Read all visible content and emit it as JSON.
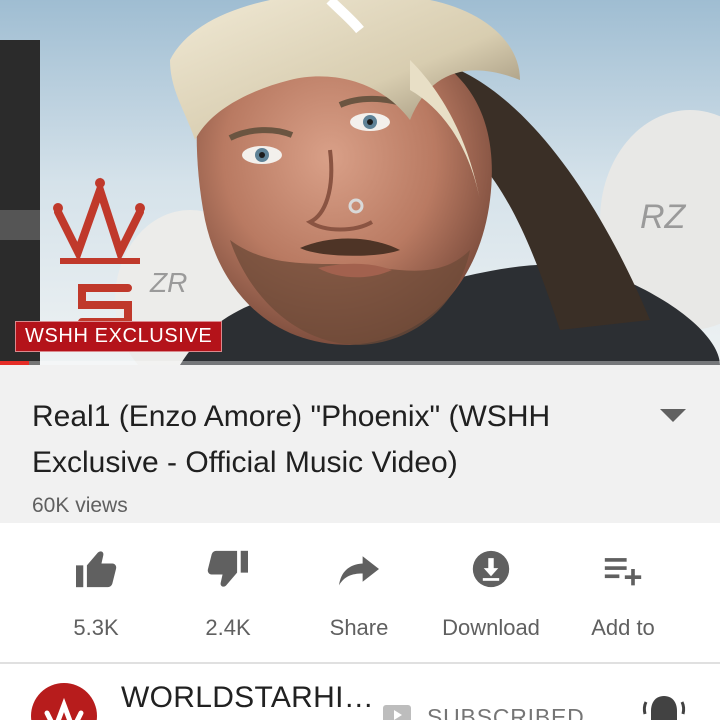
{
  "player": {
    "badge_text": "WSHH EXCLUSIVE",
    "progress_percent": 4
  },
  "video": {
    "title": "Real1 (Enzo Amore) \"Phoenix\" (WSHH Exclusive - Official Music Video)",
    "views": "60K views"
  },
  "actions": [
    {
      "name": "like",
      "label": "5.3K",
      "icon": "thumbs-up-icon"
    },
    {
      "name": "dislike",
      "label": "2.4K",
      "icon": "thumbs-down-icon"
    },
    {
      "name": "share",
      "label": "Share",
      "icon": "share-icon"
    },
    {
      "name": "download",
      "label": "Download",
      "icon": "download-icon"
    },
    {
      "name": "add-to",
      "label": "Add to",
      "icon": "playlist-add-icon"
    }
  ],
  "channel": {
    "name": "WORLDSTARHI…",
    "subscribe_state": "SUBSCRIBED"
  },
  "colors": {
    "brand_red": "#b4131a",
    "progress_red": "#e52d27",
    "icon_gray": "#606060"
  }
}
